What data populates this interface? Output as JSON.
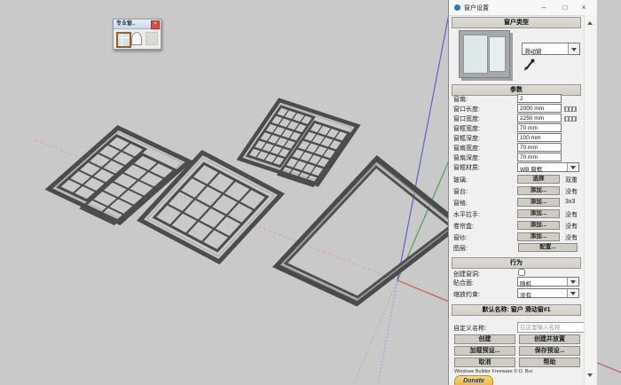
{
  "toolbar": {
    "title": "专业窗..",
    "close_label": "×"
  },
  "panel": {
    "title": "窗户设置",
    "window_controls": {
      "minimize": "–",
      "maximize": "□",
      "close": "×"
    },
    "type_section": {
      "header": "窗户类型",
      "selected": "滑动窗"
    },
    "params": {
      "header": "参数",
      "rows": [
        {
          "label": "窗扇:",
          "value": "2"
        },
        {
          "label": "窗口长度:",
          "value": "2000 mm"
        },
        {
          "label": "窗口宽度:",
          "value": "2250 mm"
        },
        {
          "label": "窗框宽度:",
          "value": "70 mm"
        },
        {
          "label": "窗框深度:",
          "value": "100 mm"
        },
        {
          "label": "窗扇宽度:",
          "value": "70 mm"
        },
        {
          "label": "窗扇深度:",
          "value": "70 mm"
        }
      ],
      "material": {
        "label": "窗框材质:",
        "value": "WB 窗框"
      },
      "glass": {
        "label": "玻璃:",
        "button": "选择",
        "note": "双重"
      },
      "sill": {
        "label": "窗台:",
        "button": "添加...",
        "note": "没有"
      },
      "panes": {
        "label": "窗格:",
        "button": "添加...",
        "note": "3x3"
      },
      "handle": {
        "label": "水平拉手:",
        "button": "添加...",
        "note": "没有"
      },
      "shutter": {
        "label": "卷帘盒:",
        "button": "添加...",
        "note": "没有"
      },
      "screen": {
        "label": "窗纱:",
        "button": "添加...",
        "note": "没有"
      },
      "layer": {
        "label": "图层:",
        "button": "配置..."
      }
    },
    "behavior": {
      "header": "行为",
      "hole_label": "创建窗洞:",
      "fit_label": "贴合面:",
      "fit_value": "随机",
      "scale_label": "缩放约束:",
      "scale_value": "没有"
    },
    "naming": {
      "default_name": "默认名称: 窗户 滑动窗#1",
      "custom_label": "自定义名称:",
      "placeholder": "在这里输入名称"
    },
    "actions": {
      "create": "创建",
      "create_place": "创建并放置",
      "load": "加载预设...",
      "save": "保存预设...",
      "cancel": "取消",
      "help": "帮助"
    },
    "footer": {
      "credit": "Windows Builder Freeware © D. Bur",
      "donate": "Donate"
    }
  },
  "colors": {
    "axis_red": "#c25b55",
    "axis_green": "#58a058",
    "axis_blue": "#5b63c8",
    "frame_dark": "#4c4c4c",
    "viewport_bg": "#c9c9c9"
  }
}
